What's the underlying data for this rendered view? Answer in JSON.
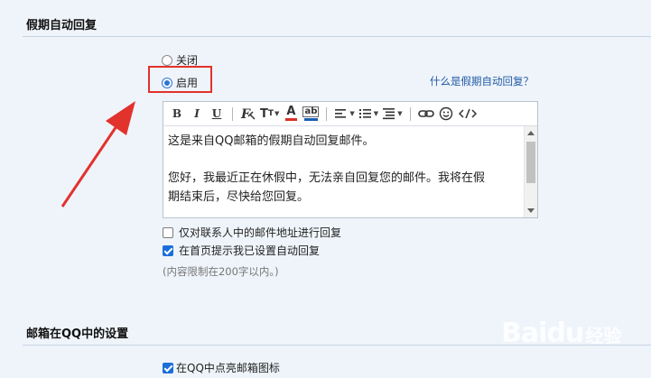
{
  "auto_reply": {
    "title": "假期自动回复",
    "option_off": "关闭",
    "option_on": "启用",
    "selected": "启用",
    "help_link": "什么是假期自动回复？",
    "toolbar": {
      "bold": "B",
      "italic": "I",
      "underline": "U",
      "font_size": "T",
      "font_color": "A",
      "bg_color": "ab"
    },
    "message": {
      "line1": "这是来自QQ邮箱的假期自动回复邮件。",
      "line2": "您好，我最近正在休假中，无法亲自回复您的邮件。我将在假",
      "line3": "期结束后，尽快给您回复。"
    },
    "options": [
      {
        "label": "仅对联系人中的邮件地址进行回复",
        "checked": false
      },
      {
        "label": "在首页提示我已设置自动回复",
        "checked": true
      }
    ],
    "hint": "(内容限制在200字以内。)"
  },
  "qq_settings": {
    "title": "邮箱在QQ中的设置",
    "option": {
      "label": "在QQ中点亮邮箱图标",
      "checked": true
    }
  },
  "watermark": {
    "text": "Baidu",
    "suffix": "经验"
  },
  "colors": {
    "page_bg": "#eff4fa",
    "accent_blue": "#1c6fd8",
    "annotation_red": "#e2322c",
    "link_blue": "#1f5aa6"
  }
}
